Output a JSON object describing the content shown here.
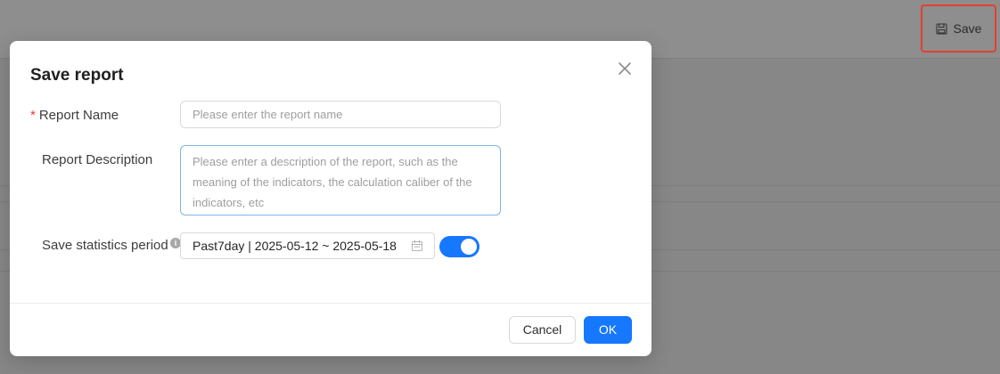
{
  "toolbar": {
    "save_label": "Save",
    "save_icon": "floppy-disk-icon"
  },
  "modal": {
    "title": "Save report",
    "close_icon": "close-icon",
    "fields": {
      "report_name": {
        "required_mark": "*",
        "label": "Report Name",
        "value": "",
        "placeholder": "Please enter the report name"
      },
      "report_description": {
        "label": "Report Description",
        "value": "",
        "placeholder": "Please enter a description of the report, such as the meaning of the indicators, the calculation caliber of the indicators, etc"
      },
      "statistics_period": {
        "label": "Save statistics period",
        "info_icon": "info-icon",
        "value": "Past7day | 2025-05-12 ~ 2025-05-18",
        "calendar_icon": "calendar-icon",
        "toggle_on": true
      }
    },
    "footer": {
      "cancel_label": "Cancel",
      "ok_label": "OK"
    }
  },
  "colors": {
    "primary": "#1677ff",
    "highlight_border": "#e0432f",
    "required": "#e53935"
  }
}
